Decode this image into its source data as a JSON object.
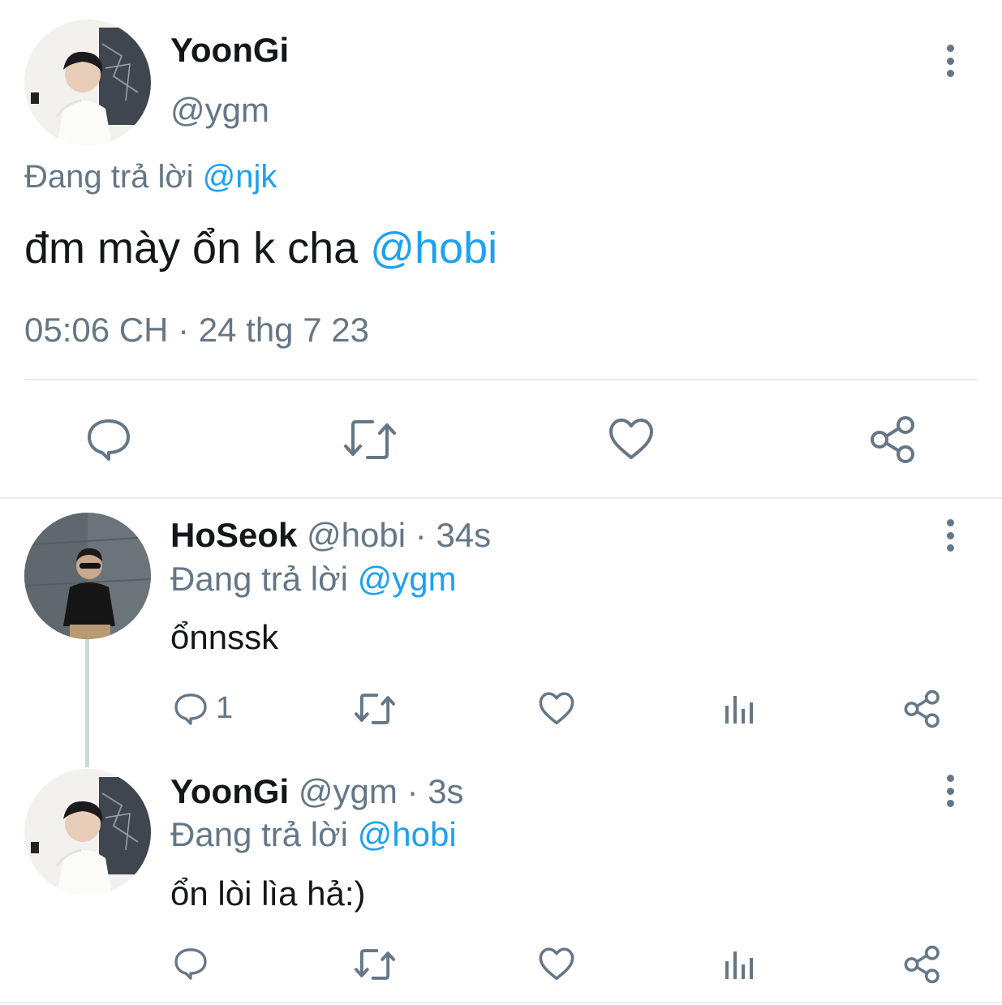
{
  "main_tweet": {
    "author_name": "YoonGi",
    "author_handle": "@ygm",
    "replying_prefix": "Đang trả lời",
    "replying_to": "@njk",
    "text_main": "đm mày ổn k cha",
    "text_mention": "@hobi",
    "timestamp": "05:06 CH · 24 thg 7 23",
    "actions": [
      "reply-icon",
      "retweet-icon",
      "like-icon",
      "share-icon"
    ]
  },
  "replies": [
    {
      "author_name": "HoSeok",
      "author_handle": "@hobi",
      "separator": "·",
      "time": "34s",
      "replying_prefix": "Đang trả lời",
      "replying_to": "@ygm",
      "text": "ổnnssk",
      "reply_count": "1"
    },
    {
      "author_name": "YoonGi",
      "author_handle": "@ygm",
      "separator": "·",
      "time": "3s",
      "replying_prefix": "Đang trả lời",
      "replying_to": "@hobi",
      "text": "ổn lòi lìa hả:)",
      "reply_count": ""
    }
  ],
  "colors": {
    "text": "#14171a",
    "muted": "#657786",
    "link": "#1da1f2",
    "divider": "#e6ecf0"
  }
}
